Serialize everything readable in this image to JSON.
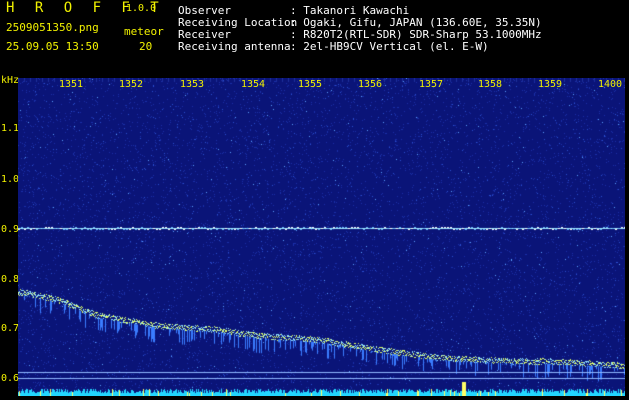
{
  "title": "H R O F F T",
  "version": "1.0.0",
  "filename": "2509051350.png",
  "meteor_label": "meteor",
  "datetime": "25.09.05 13:50",
  "meteor_count": "20",
  "info": [
    {
      "label": "Observer",
      "value": ": Takanori Kawachi"
    },
    {
      "label": "Receiving Location",
      "value": ": Ogaki, Gifu, JAPAN (136.60E, 35.35N)"
    },
    {
      "label": "Receiver",
      "value": ": R820T2(RTL-SDR) SDR-Sharp 53.1000MHz"
    },
    {
      "label": "Receiving antenna",
      "value": ": 2el-HB9CV Vertical (el. E-W)"
    }
  ],
  "y_unit": "kHz",
  "y_ticks": [
    "1.1",
    "1.0",
    "0.9",
    "0.8",
    "0.7",
    "0.6"
  ],
  "x_ticks": [
    "1351",
    "1352",
    "1353",
    "1354",
    "1355",
    "1356",
    "1357",
    "1358",
    "1359",
    "1400"
  ],
  "colors": {
    "label": "#f2f200",
    "background": "#0a1478",
    "signal": "#dfff6a",
    "carrier": "#9fe8ff"
  }
}
